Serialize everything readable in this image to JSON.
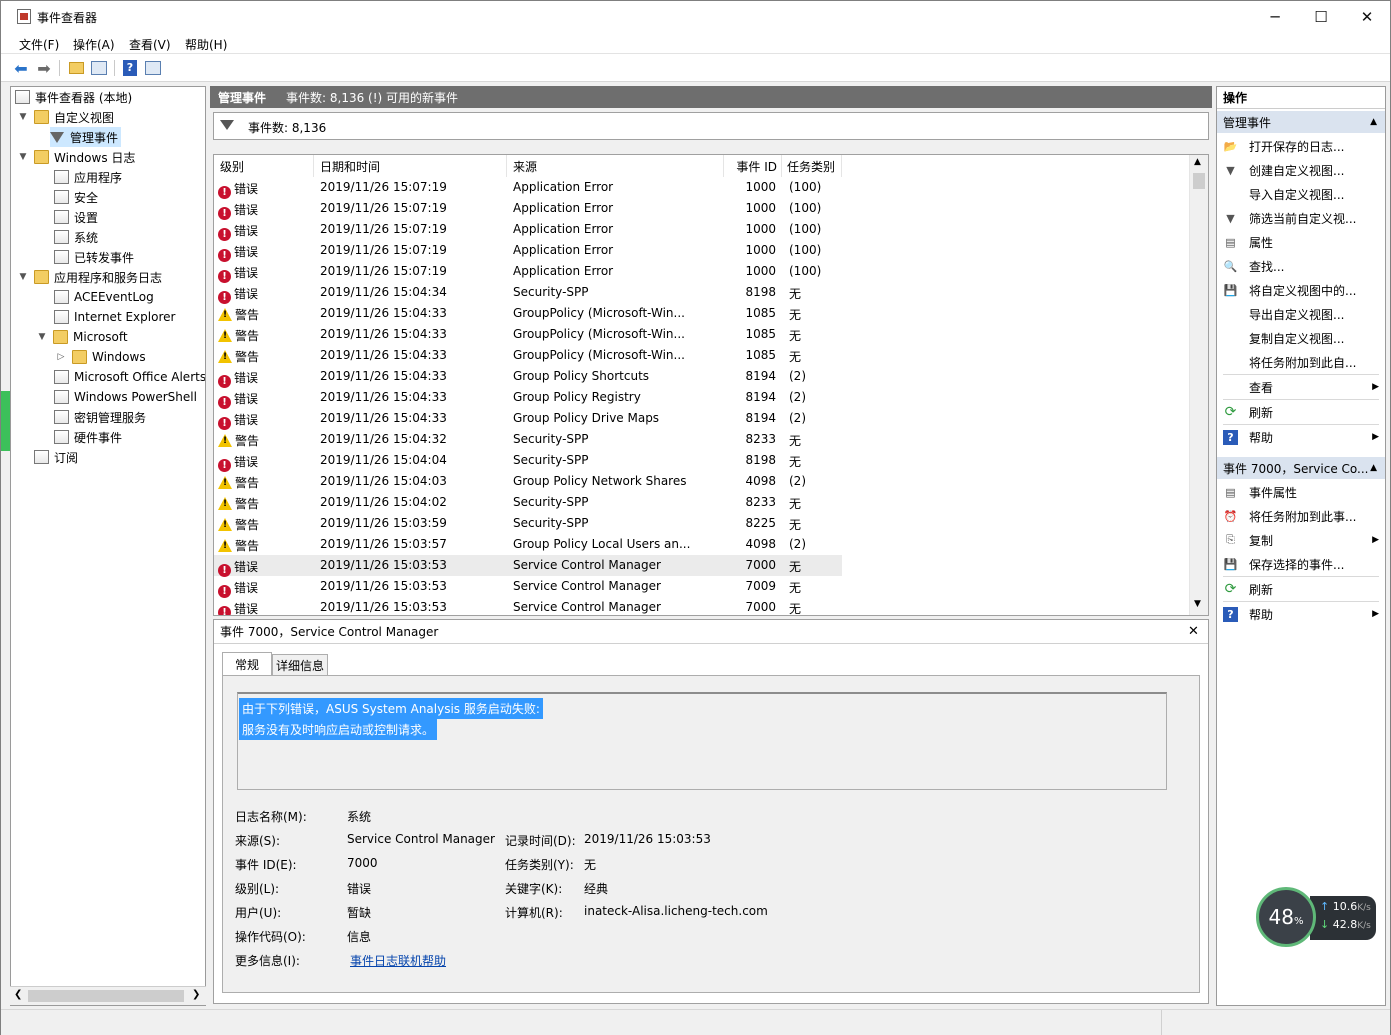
{
  "window": {
    "title": "事件查看器",
    "controls": {
      "minimize": "─",
      "maximize": "☐",
      "close": "✕"
    }
  },
  "menu": [
    "文件(F)",
    "操作(A)",
    "查看(V)",
    "帮助(H)"
  ],
  "tree": {
    "root": "事件查看器 (本地)",
    "custom_views": "自定义视图",
    "managed_events": "管理事件",
    "windows_logs": "Windows 日志",
    "app": "应用程序",
    "security": "安全",
    "setup": "设置",
    "system": "系统",
    "forwarded": "已转发事件",
    "app_service_logs": "应用程序和服务日志",
    "ace": "ACEEventLog",
    "ie": "Internet Explorer",
    "microsoft": "Microsoft",
    "windows": "Windows",
    "office_alerts": "Microsoft Office Alerts",
    "powershell": "Windows PowerShell",
    "key_mgmt": "密钥管理服务",
    "hardware": "硬件事件",
    "subscriptions": "订阅"
  },
  "center": {
    "header_title": "管理事件",
    "header_count": "事件数: 8,136 (!) 可用的新事件",
    "filter_count": "事件数: 8,136",
    "columns": [
      "级别",
      "日期和时间",
      "来源",
      "事件 ID",
      "任务类别"
    ],
    "rows": [
      {
        "kind": "err",
        "level": "错误",
        "time": "2019/11/26 15:07:19",
        "source": "Application Error",
        "id": "1000",
        "task": "(100)"
      },
      {
        "kind": "err",
        "level": "错误",
        "time": "2019/11/26 15:07:19",
        "source": "Application Error",
        "id": "1000",
        "task": "(100)"
      },
      {
        "kind": "err",
        "level": "错误",
        "time": "2019/11/26 15:07:19",
        "source": "Application Error",
        "id": "1000",
        "task": "(100)"
      },
      {
        "kind": "err",
        "level": "错误",
        "time": "2019/11/26 15:07:19",
        "source": "Application Error",
        "id": "1000",
        "task": "(100)"
      },
      {
        "kind": "err",
        "level": "错误",
        "time": "2019/11/26 15:07:19",
        "source": "Application Error",
        "id": "1000",
        "task": "(100)"
      },
      {
        "kind": "err",
        "level": "错误",
        "time": "2019/11/26 15:04:34",
        "source": "Security-SPP",
        "id": "8198",
        "task": "无"
      },
      {
        "kind": "warn",
        "level": "警告",
        "time": "2019/11/26 15:04:33",
        "source": "GroupPolicy (Microsoft-Win...",
        "id": "1085",
        "task": "无"
      },
      {
        "kind": "warn",
        "level": "警告",
        "time": "2019/11/26 15:04:33",
        "source": "GroupPolicy (Microsoft-Win...",
        "id": "1085",
        "task": "无"
      },
      {
        "kind": "warn",
        "level": "警告",
        "time": "2019/11/26 15:04:33",
        "source": "GroupPolicy (Microsoft-Win...",
        "id": "1085",
        "task": "无"
      },
      {
        "kind": "err",
        "level": "错误",
        "time": "2019/11/26 15:04:33",
        "source": "Group Policy Shortcuts",
        "id": "8194",
        "task": "(2)"
      },
      {
        "kind": "err",
        "level": "错误",
        "time": "2019/11/26 15:04:33",
        "source": "Group Policy Registry",
        "id": "8194",
        "task": "(2)"
      },
      {
        "kind": "err",
        "level": "错误",
        "time": "2019/11/26 15:04:33",
        "source": "Group Policy Drive Maps",
        "id": "8194",
        "task": "(2)"
      },
      {
        "kind": "warn",
        "level": "警告",
        "time": "2019/11/26 15:04:32",
        "source": "Security-SPP",
        "id": "8233",
        "task": "无"
      },
      {
        "kind": "err",
        "level": "错误",
        "time": "2019/11/26 15:04:04",
        "source": "Security-SPP",
        "id": "8198",
        "task": "无"
      },
      {
        "kind": "warn",
        "level": "警告",
        "time": "2019/11/26 15:04:03",
        "source": "Group Policy Network Shares",
        "id": "4098",
        "task": "(2)"
      },
      {
        "kind": "warn",
        "level": "警告",
        "time": "2019/11/26 15:04:02",
        "source": "Security-SPP",
        "id": "8233",
        "task": "无"
      },
      {
        "kind": "warn",
        "level": "警告",
        "time": "2019/11/26 15:03:59",
        "source": "Security-SPP",
        "id": "8225",
        "task": "无"
      },
      {
        "kind": "warn",
        "level": "警告",
        "time": "2019/11/26 15:03:57",
        "source": "Group Policy Local Users an...",
        "id": "4098",
        "task": "(2)"
      },
      {
        "kind": "err",
        "level": "错误",
        "time": "2019/11/26 15:03:53",
        "source": "Service Control Manager",
        "id": "7000",
        "task": "无"
      },
      {
        "kind": "err",
        "level": "错误",
        "time": "2019/11/26 15:03:53",
        "source": "Service Control Manager",
        "id": "7009",
        "task": "无"
      },
      {
        "kind": "err",
        "level": "错误",
        "time": "2019/11/26 15:03:53",
        "source": "Service Control Manager",
        "id": "7000",
        "task": "无"
      }
    ],
    "selected_row": 18
  },
  "detail": {
    "title": "事件 7000，Service Control Manager",
    "tab_general": "常规",
    "tab_details": "详细信息",
    "desc_line1": "由于下列错误，ASUS System Analysis 服务启动失败:",
    "desc_line2": "服务没有及时响应启动或控制请求。",
    "log_name_label": "日志名称(M):",
    "log_name": "系统",
    "source_label": "来源(S):",
    "source": "Service Control Manager",
    "logged_label": "记录时间(D):",
    "logged": "2019/11/26 15:03:53",
    "event_id_label": "事件 ID(E):",
    "event_id": "7000",
    "task_label": "任务类别(Y):",
    "task": "无",
    "level_label": "级别(L):",
    "level": "错误",
    "keywords_label": "关键字(K):",
    "keywords": "经典",
    "user_label": "用户(U):",
    "user": "暂缺",
    "computer_label": "计算机(R):",
    "computer": "inateck-Alisa.licheng-tech.com",
    "opcode_label": "操作代码(O):",
    "opcode": "信息",
    "more_label": "更多信息(I):",
    "more_link": "事件日志联机帮助"
  },
  "actions": {
    "title": "操作",
    "group1": "管理事件",
    "items1": [
      "打开保存的日志...",
      "创建自定义视图...",
      "导入自定义视图...",
      "筛选当前自定义视...",
      "属性",
      "查找...",
      "将自定义视图中的...",
      "导出自定义视图...",
      "复制自定义视图...",
      "将任务附加到此自...",
      "查看",
      "刷新",
      "帮助"
    ],
    "group2": "事件 7000，Service Co...",
    "items2": [
      "事件属性",
      "将任务附加到此事...",
      "复制",
      "保存选择的事件...",
      "刷新",
      "帮助"
    ]
  },
  "widget": {
    "percent": "48",
    "percent_sign": "%",
    "up": "10.6",
    "down": "42.8",
    "unit": "K/s"
  }
}
